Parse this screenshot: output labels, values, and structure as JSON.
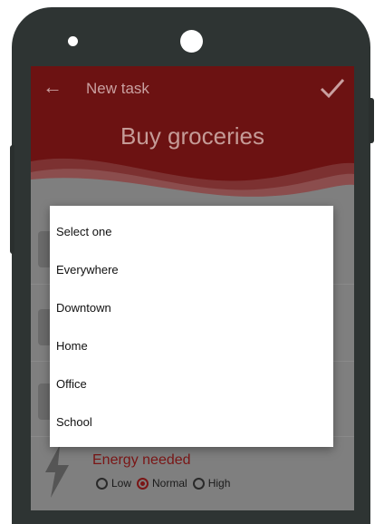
{
  "app": {
    "title": "New task",
    "task_name": "Buy groceries",
    "back_icon": "arrow-left-icon",
    "confirm_icon": "checkmark-icon"
  },
  "dialog": {
    "options": [
      {
        "label": "Select one"
      },
      {
        "label": "Everywhere"
      },
      {
        "label": "Downtown"
      },
      {
        "label": "Home"
      },
      {
        "label": "Office"
      },
      {
        "label": "School"
      }
    ]
  },
  "energy": {
    "label": "Energy needed",
    "icon": "lightning-bolt-icon",
    "options": [
      {
        "label": "Low",
        "selected": false
      },
      {
        "label": "Normal",
        "selected": true
      },
      {
        "label": "High",
        "selected": false
      }
    ]
  },
  "colors": {
    "header": "#6c1212",
    "accent": "#7a1616",
    "phone": "#2e3433"
  }
}
